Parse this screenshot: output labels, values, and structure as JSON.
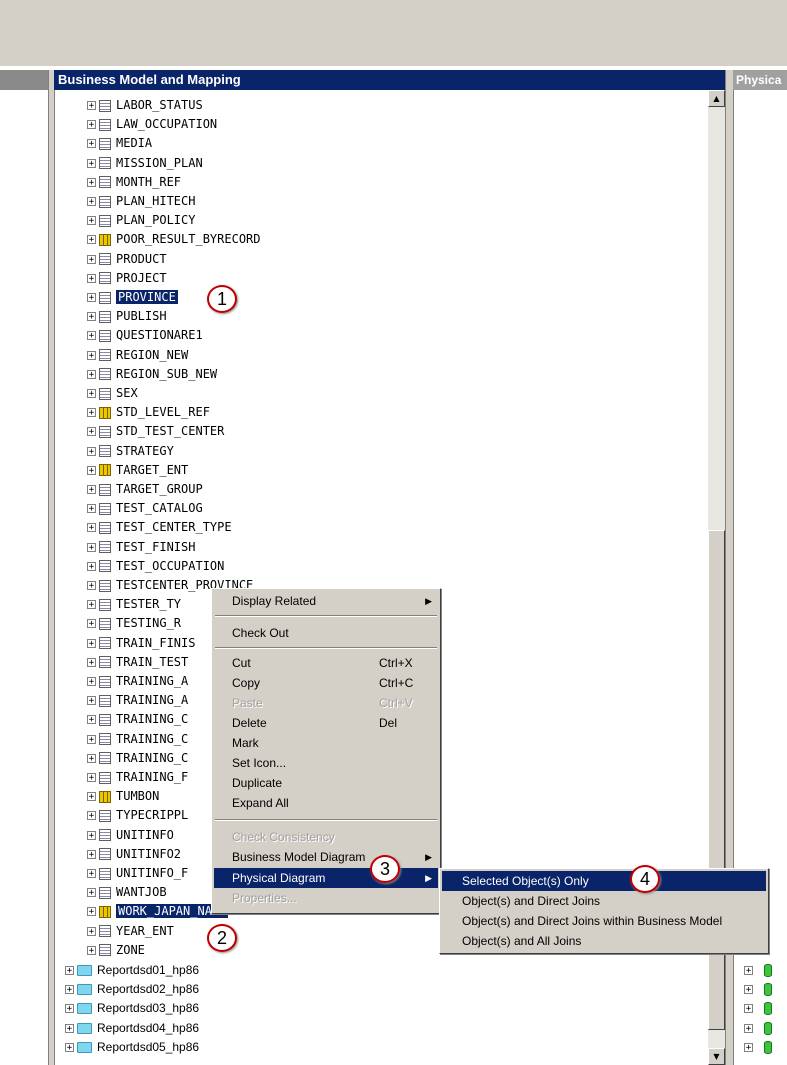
{
  "panels": {
    "business_model_title": "Business Model and Mapping",
    "physical_title": "Physica"
  },
  "tree_items": [
    {
      "label": "LABOR_STATUS",
      "icon": "table",
      "selected": false
    },
    {
      "label": "LAW_OCCUPATION",
      "icon": "table",
      "selected": false
    },
    {
      "label": "MEDIA",
      "icon": "table",
      "selected": false
    },
    {
      "label": "MISSION_PLAN",
      "icon": "table",
      "selected": false
    },
    {
      "label": "MONTH_REF",
      "icon": "table",
      "selected": false
    },
    {
      "label": "PLAN_HITECH",
      "icon": "table",
      "selected": false
    },
    {
      "label": "PLAN_POLICY",
      "icon": "table",
      "selected": false
    },
    {
      "label": "POOR_RESULT_BYRECORD",
      "icon": "fact-table",
      "selected": false
    },
    {
      "label": "PRODUCT",
      "icon": "table",
      "selected": false
    },
    {
      "label": "PROJECT",
      "icon": "table",
      "selected": false
    },
    {
      "label": "PROVINCE",
      "icon": "table",
      "selected": true
    },
    {
      "label": "PUBLISH",
      "icon": "table",
      "selected": false
    },
    {
      "label": "QUESTIONARE1",
      "icon": "table",
      "selected": false
    },
    {
      "label": "REGION_NEW",
      "icon": "table",
      "selected": false
    },
    {
      "label": "REGION_SUB_NEW",
      "icon": "table",
      "selected": false
    },
    {
      "label": "SEX",
      "icon": "table",
      "selected": false
    },
    {
      "label": "STD_LEVEL_REF",
      "icon": "fact-table",
      "selected": false
    },
    {
      "label": "STD_TEST_CENTER",
      "icon": "table",
      "selected": false
    },
    {
      "label": "STRATEGY",
      "icon": "table",
      "selected": false
    },
    {
      "label": "TARGET_ENT",
      "icon": "fact-table",
      "selected": false
    },
    {
      "label": "TARGET_GROUP",
      "icon": "table",
      "selected": false
    },
    {
      "label": "TEST_CATALOG",
      "icon": "table",
      "selected": false
    },
    {
      "label": "TEST_CENTER_TYPE",
      "icon": "table",
      "selected": false
    },
    {
      "label": "TEST_FINISH",
      "icon": "table",
      "selected": false
    },
    {
      "label": "TEST_OCCUPATION",
      "icon": "table",
      "selected": false
    },
    {
      "label": "TESTCENTER_PROVINCE",
      "icon": "table",
      "selected": false
    },
    {
      "label": "TESTER_TY",
      "icon": "table",
      "selected": false
    },
    {
      "label": "TESTING_R",
      "icon": "table",
      "selected": false
    },
    {
      "label": "TRAIN_FINIS",
      "icon": "table",
      "selected": false
    },
    {
      "label": "TRAIN_TEST",
      "icon": "table",
      "selected": false
    },
    {
      "label": "TRAINING_A",
      "icon": "table",
      "selected": false
    },
    {
      "label": "TRAINING_A",
      "icon": "table",
      "selected": false
    },
    {
      "label": "TRAINING_C",
      "icon": "table",
      "selected": false
    },
    {
      "label": "TRAINING_C",
      "icon": "table",
      "selected": false
    },
    {
      "label": "TRAINING_C",
      "icon": "table",
      "selected": false
    },
    {
      "label": "TRAINING_F",
      "icon": "table",
      "selected": false
    },
    {
      "label": "TUMBON",
      "icon": "fact-table",
      "selected": false
    },
    {
      "label": "TYPECRIPPL",
      "icon": "table",
      "selected": false
    },
    {
      "label": "UNITINFO",
      "icon": "table",
      "selected": false
    },
    {
      "label": "UNITINFO2",
      "icon": "table",
      "selected": false
    },
    {
      "label": "UNITINFO_F",
      "icon": "table",
      "selected": false
    },
    {
      "label": "WANTJOB",
      "icon": "table",
      "selected": false
    },
    {
      "label": "WORK_JAPAN_NAME",
      "icon": "fact-table",
      "selected": true
    },
    {
      "label": "YEAR_ENT",
      "icon": "table",
      "selected": false
    },
    {
      "label": "ZONE",
      "icon": "table",
      "selected": false
    }
  ],
  "folders": [
    "Reportdsd01_hp86",
    "Reportdsd02_hp86",
    "Reportdsd03_hp86",
    "Reportdsd04_hp86",
    "Reportdsd05_hp86"
  ],
  "context_menu": {
    "display_related": "Display Related",
    "check_out": "Check Out",
    "cut": "Cut",
    "cut_shortcut": "Ctrl+X",
    "copy": "Copy",
    "copy_shortcut": "Ctrl+C",
    "paste": "Paste",
    "paste_shortcut": "Ctrl+V",
    "delete": "Delete",
    "delete_shortcut": "Del",
    "mark": "Mark",
    "set_icon": "Set Icon...",
    "duplicate": "Duplicate",
    "expand_all": "Expand All",
    "check_consistency": "Check Consistency",
    "business_model_diagram": "Business Model Diagram",
    "physical_diagram": "Physical Diagram",
    "properties": "Properties..."
  },
  "submenu": {
    "items": [
      "Selected Object(s) Only",
      "Object(s) and Direct Joins",
      "Object(s) and Direct Joins within Business Model",
      "Object(s) and All Joins"
    ]
  },
  "callouts": [
    "1",
    "2",
    "3",
    "4"
  ],
  "colors": {
    "selection": "#0a246a",
    "chrome": "#d4d0c8",
    "callout_border": "#c00000",
    "fact_icon": "#e8c800",
    "folder_icon": "#7fd7ef",
    "db_icon": "#3ec33e"
  }
}
